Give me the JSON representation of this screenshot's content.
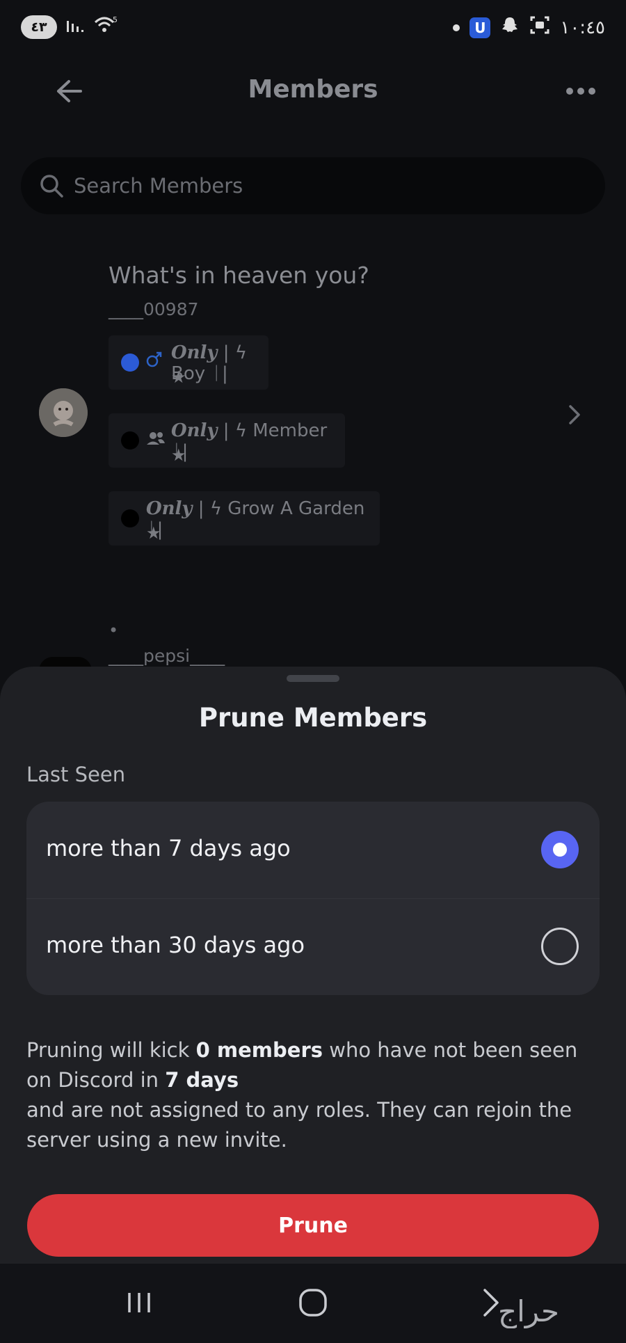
{
  "status_bar": {
    "battery": "٤٣",
    "time": "١٠:٤٥",
    "wifi_label": "5"
  },
  "header": {
    "title": "Members"
  },
  "search": {
    "placeholder": "Search Members"
  },
  "members": [
    {
      "name": "What's in heaven you?",
      "username": "____00987",
      "roles": [
        {
          "prefix": "Only",
          "text": " | ϟ Boy ᛁ|",
          "star": "★",
          "color": "#2c5bd6"
        },
        {
          "prefix": "Only",
          "text": " | ϟ Member ᛁ|",
          "star": "★",
          "color": "#000000"
        },
        {
          "prefix": "Only",
          "text": " | ϟ Grow A Garden ᛁ|",
          "star": "★",
          "color": "#000000"
        }
      ]
    },
    {
      "name": "•",
      "username": "____pepsi____"
    }
  ],
  "sheet": {
    "title": "Prune Members",
    "section_label": "Last Seen",
    "options": [
      {
        "label": "more than 7 days ago",
        "selected": true
      },
      {
        "label": "more than 30 days ago",
        "selected": false
      }
    ],
    "description": {
      "part1": "Pruning will kick ",
      "count_bold": "0 members",
      "part2": " who have not been seen on Discord in ",
      "days_bold": "7 days",
      "part3": "and are not assigned to any roles. They can rejoin the server using a new invite."
    },
    "prune_button": "Prune"
  },
  "watermark": "حراج",
  "colors": {
    "accent": "#5865f2",
    "danger": "#da373c",
    "sheet_bg": "#1f2024"
  }
}
